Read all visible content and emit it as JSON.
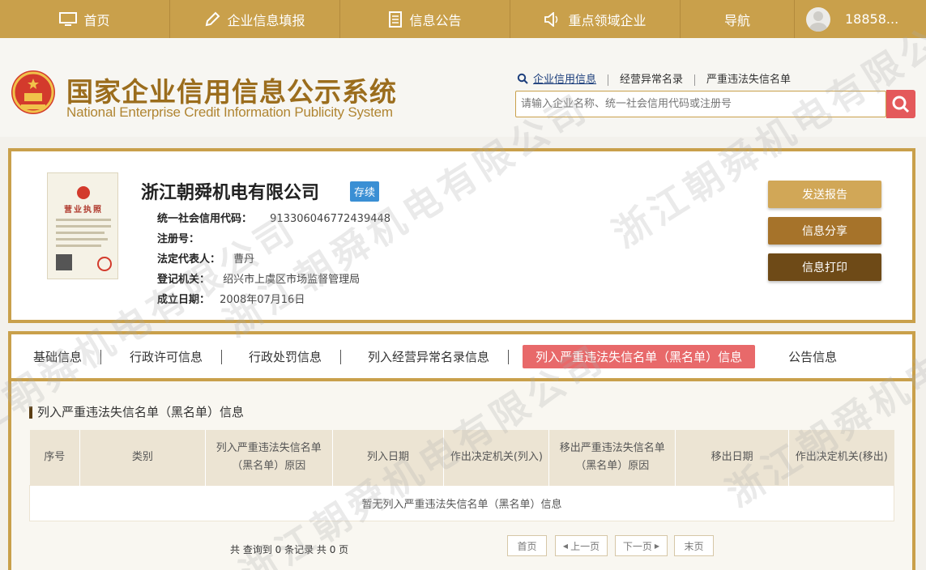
{
  "nav": {
    "home": "首页",
    "fill": "企业信息填报",
    "notice": "信息公告",
    "key": "重点领域企业",
    "guide": "导航",
    "user": "18858..."
  },
  "header": {
    "title": "国家企业信用信息公示系统",
    "subtitle": "National Enterprise Credit Information Publicity System",
    "search_tabs": [
      "企业信用信息",
      "经营异常名录",
      "严重违法失信名单"
    ],
    "search_placeholder": "请输入企业名称、统一社会信用代码或注册号"
  },
  "company": {
    "name": "浙江朝舜机电有限公司",
    "status": "存续",
    "license_label": "营业执照",
    "fields": [
      {
        "label": "统一社会信用代码：",
        "value": "913306046772439448"
      },
      {
        "label": "注册号：",
        "value": ""
      },
      {
        "label": "法定代表人：",
        "value": "曹丹"
      },
      {
        "label": "登记机关：",
        "value": "绍兴市上虞区市场监督管理局"
      },
      {
        "label": "成立日期：",
        "value": "2008年07月16日"
      }
    ],
    "buttons": [
      "发送报告",
      "信息分享",
      "信息打印"
    ]
  },
  "tabs": [
    "基础信息",
    "行政许可信息",
    "行政处罚信息",
    "列入经营异常名录信息",
    "列入严重违法失信名单（黑名单）信息",
    "公告信息"
  ],
  "section": {
    "title": "列入严重违法失信名单（黑名单）信息",
    "headers": [
      "序号",
      "类别",
      "列入严重违法失信名单（黑名单）原因",
      "列入日期",
      "作出决定机关(列入)",
      "移出严重违法失信名单（黑名单）原因",
      "移出日期",
      "作出决定机关(移出)"
    ],
    "empty": "暂无列入严重违法失信名单（黑名单）信息"
  },
  "pager": {
    "info": "共 查询到 0 条记录 共 0 页",
    "first": "首页",
    "prev": "上一页",
    "next": "下一页",
    "last": "末页"
  },
  "watermark": "浙江朝舜机电有限公司",
  "colors": {
    "gold": "#c9a04b",
    "red": "#e8696a",
    "blue": "#3a8fd4"
  }
}
